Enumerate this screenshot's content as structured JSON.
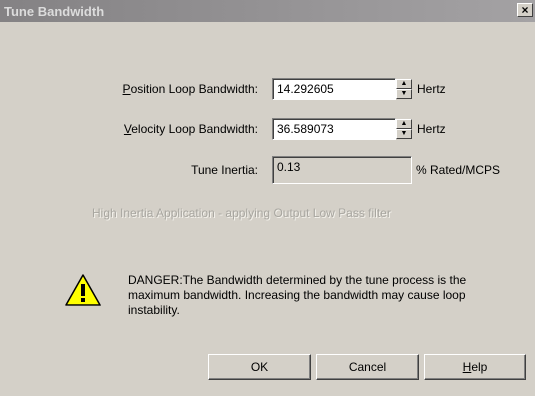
{
  "window": {
    "title": "Tune Bandwidth",
    "close_label": "×"
  },
  "fields": {
    "position": {
      "label_key": "P",
      "label_rest": "osition Loop Bandwidth:",
      "value": "14.292605",
      "unit": "Hertz"
    },
    "velocity": {
      "label_key": "V",
      "label_rest": "elocity Loop Bandwidth:",
      "value": "36.589073",
      "unit": "Hertz"
    },
    "inertia": {
      "label": "Tune Inertia:",
      "value": "0.13",
      "unit": "% Rated/MCPS"
    }
  },
  "status_text": "High Inertia Application - applying Output Low Pass filter",
  "warning": {
    "icon": "warning-icon",
    "text": "DANGER:The Bandwidth determined by the tune process is the maximum bandwidth. Increasing the bandwidth may cause loop instability."
  },
  "buttons": {
    "ok": "OK",
    "cancel": "Cancel",
    "help_key": "H",
    "help_rest": "elp"
  },
  "spinner": {
    "up_glyph": "▲",
    "down_glyph": "▼"
  }
}
